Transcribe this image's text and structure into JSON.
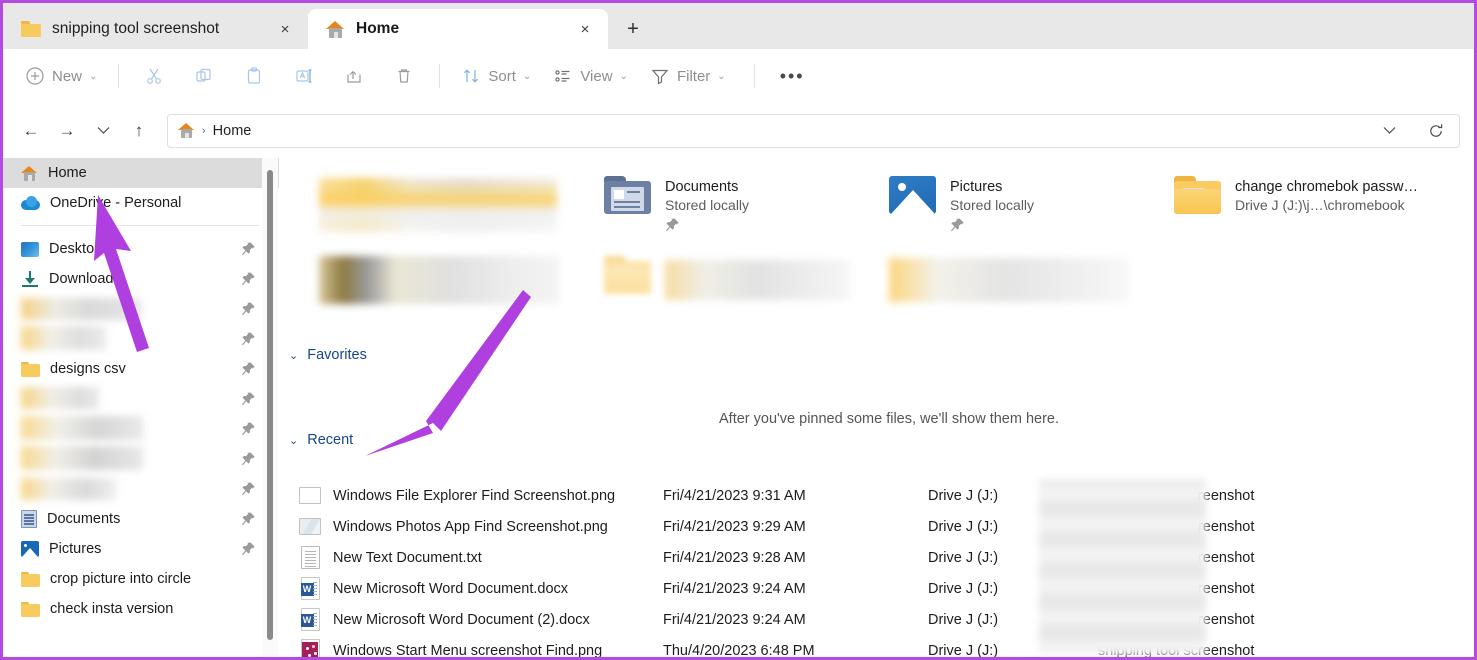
{
  "window": {
    "border_color": "#b44ae0",
    "tabs": [
      {
        "label": "snipping tool screenshot",
        "icon": "folder-icon",
        "active": false,
        "close_label": "×"
      },
      {
        "label": "Home",
        "icon": "home-icon",
        "active": true,
        "close_label": "×"
      }
    ],
    "new_tab_label": "+"
  },
  "toolbar": {
    "new_label": "New",
    "sort_label": "Sort",
    "view_label": "View",
    "filter_label": "Filter",
    "overflow_label": "•••",
    "chevron": "⌄",
    "icons": [
      "cut-icon",
      "copy-icon",
      "paste-icon",
      "rename-icon",
      "share-icon",
      "delete-icon"
    ]
  },
  "addressbar": {
    "back_label": "←",
    "forward_label": "→",
    "recent_label": "⌄",
    "up_label": "↑",
    "home_icon": "home-icon",
    "separator": "›",
    "crumb": "Home",
    "dropdown_label": "⌄",
    "refresh_label": "↻"
  },
  "sidebar": {
    "items": [
      {
        "label": "Home",
        "icon": "home-icon",
        "selected": true,
        "pinned": false,
        "blurred": false
      },
      {
        "label": "OneDrive - Personal",
        "icon": "cloud-icon",
        "selected": false,
        "pinned": false,
        "blurred": false
      },
      {
        "divider": true
      },
      {
        "label": "Desktop",
        "icon": "desktop-icon",
        "selected": false,
        "pinned": true,
        "blurred": false
      },
      {
        "label": "Downloads",
        "icon": "downloads-icon",
        "selected": false,
        "pinned": true,
        "blurred": false
      },
      {
        "label": "",
        "icon": "folder-icon",
        "selected": false,
        "pinned": true,
        "blurred": true
      },
      {
        "label": "",
        "icon": "folder-icon",
        "selected": false,
        "pinned": true,
        "blurred": true
      },
      {
        "label": "designs csv",
        "icon": "folder-icon",
        "selected": false,
        "pinned": true,
        "blurred": false
      },
      {
        "label": "",
        "icon": "folder-icon",
        "selected": false,
        "pinned": true,
        "blurred": true
      },
      {
        "label": "",
        "icon": "folder-icon",
        "selected": false,
        "pinned": true,
        "blurred": true
      },
      {
        "label": "",
        "icon": "folder-icon",
        "selected": false,
        "pinned": true,
        "blurred": true
      },
      {
        "label": "",
        "icon": "folder-icon",
        "selected": false,
        "pinned": true,
        "blurred": true
      },
      {
        "label": "Documents",
        "icon": "documents-icon",
        "selected": false,
        "pinned": true,
        "blurred": false
      },
      {
        "label": "Pictures",
        "icon": "pictures-icon",
        "selected": false,
        "pinned": true,
        "blurred": false
      },
      {
        "label": "crop picture into circle",
        "icon": "folder-icon",
        "selected": false,
        "pinned": false,
        "blurred": false
      },
      {
        "label": "check insta version",
        "icon": "folder-icon",
        "selected": false,
        "pinned": false,
        "blurred": false
      }
    ]
  },
  "quick_access": {
    "tiles": [
      {
        "name": "",
        "sub": "",
        "icon": "folder-icon",
        "pinned": false,
        "blurred": true
      },
      {
        "name": "Documents",
        "sub": "Stored locally",
        "icon": "documents-folder-icon",
        "pinned": true,
        "blurred": false
      },
      {
        "name": "Pictures",
        "sub": "Stored locally",
        "icon": "pictures-folder-icon",
        "pinned": true,
        "blurred": false
      },
      {
        "name": "change chromebok passw…",
        "sub": "Drive J (J:)\\j…\\chromebook",
        "icon": "folder-file-icon",
        "pinned": false,
        "blurred": false
      },
      {
        "name": "",
        "sub": "",
        "icon": "folder-icon",
        "pinned": false,
        "blurred": true
      },
      {
        "name": "",
        "sub": "",
        "icon": "folder-file-icon",
        "pinned": false,
        "blurred": true
      },
      {
        "name": "",
        "sub": "",
        "icon": "folder-icon",
        "pinned": false,
        "blurred": true
      },
      {
        "name": "",
        "sub": "",
        "icon": "folder-icon",
        "pinned": false,
        "blurred": true
      }
    ]
  },
  "sections": {
    "favorites_label": "Favorites",
    "recent_label": "Recent",
    "chevron": "⌄",
    "empty_message": "After you've pinned some files, we'll show them here."
  },
  "recent_files": [
    {
      "name": "Windows File Explorer Find Screenshot.png",
      "date": "Fri/4/21/2023 9:31 AM",
      "drive": "Drive J (J:)",
      "folder": "snipping tool screenshot",
      "icon": "png-blank-icon"
    },
    {
      "name": "Windows Photos App Find Screenshot.png",
      "date": "Fri/4/21/2023 9:29 AM",
      "drive": "Drive J (J:)",
      "folder": "snipping tool screenshot",
      "icon": "png-image-icon"
    },
    {
      "name": "New Text Document.txt",
      "date": "Fri/4/21/2023 9:28 AM",
      "drive": "Drive J (J:)",
      "folder": "snipping tool screenshot",
      "icon": "txt-icon"
    },
    {
      "name": "New Microsoft Word Document.docx",
      "date": "Fri/4/21/2023 9:24 AM",
      "drive": "Drive J (J:)",
      "folder": "snipping tool screenshot",
      "icon": "word-icon"
    },
    {
      "name": "New Microsoft Word Document (2).docx",
      "date": "Fri/4/21/2023 9:24 AM",
      "drive": "Drive J (J:)",
      "folder": "snipping tool screenshot",
      "icon": "word-icon"
    },
    {
      "name": "Windows Start Menu screenshot Find.png",
      "date": "Thu/4/20/2023 6:48 PM",
      "drive": "Drive J (J:)",
      "folder": "snipping tool screenshot",
      "icon": "start-menu-icon"
    }
  ],
  "annotations": {
    "arrow_color": "#b03fe0",
    "arrows": [
      {
        "name": "arrow-to-home",
        "points_to": "Home"
      },
      {
        "name": "arrow-to-recent",
        "points_to": "Recent"
      }
    ]
  }
}
